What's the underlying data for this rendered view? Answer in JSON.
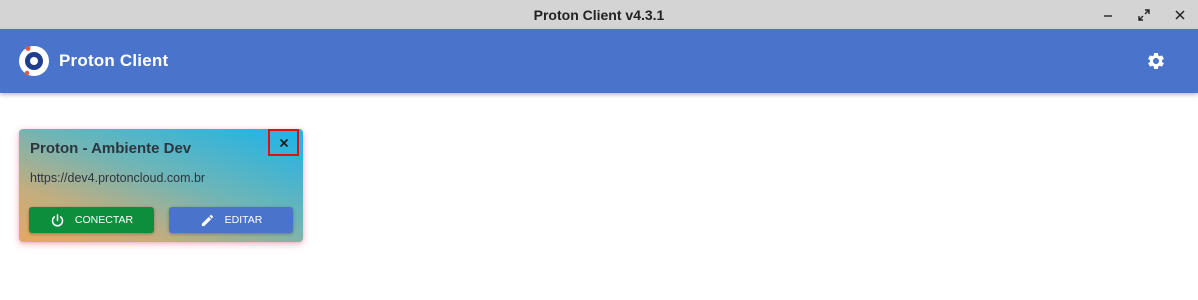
{
  "window": {
    "title": "Proton Client v4.3.1",
    "controls": [
      "minimize-icon",
      "maximize-icon",
      "close-icon"
    ]
  },
  "appbar": {
    "title": "Proton Client",
    "logo_icon": "proton-logo-icon",
    "settings_icon": "gear-icon",
    "background": "#4a74cc"
  },
  "connection_card": {
    "title": "Proton - Ambiente Dev",
    "url": "https://dev4.protoncloud.com.br",
    "close_icon": "close-icon",
    "connect_button": {
      "label": "CONECTAR",
      "icon": "power-icon",
      "color": "#0c8f3c"
    },
    "edit_button": {
      "label": "EDITAR",
      "icon": "pencil-icon",
      "color": "#4a74cc"
    }
  }
}
